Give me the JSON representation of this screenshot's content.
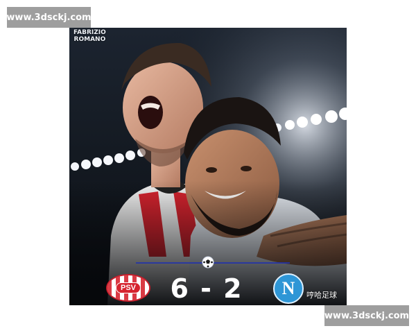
{
  "watermarks": {
    "top": "www.3dsckj.com",
    "bottom": "www.3dsckj.com"
  },
  "photo": {
    "credit_line1": "FABRIZIO",
    "credit_line2": "ROMANO",
    "home_badge_text": "PSV",
    "away_badge_text": "N",
    "score": "6 - 2",
    "source_label": "哼哈足球"
  },
  "colors": {
    "psv_red": "#d6242f",
    "napoli_blue": "#2e96d6",
    "ucl_line": "#2233aa"
  }
}
